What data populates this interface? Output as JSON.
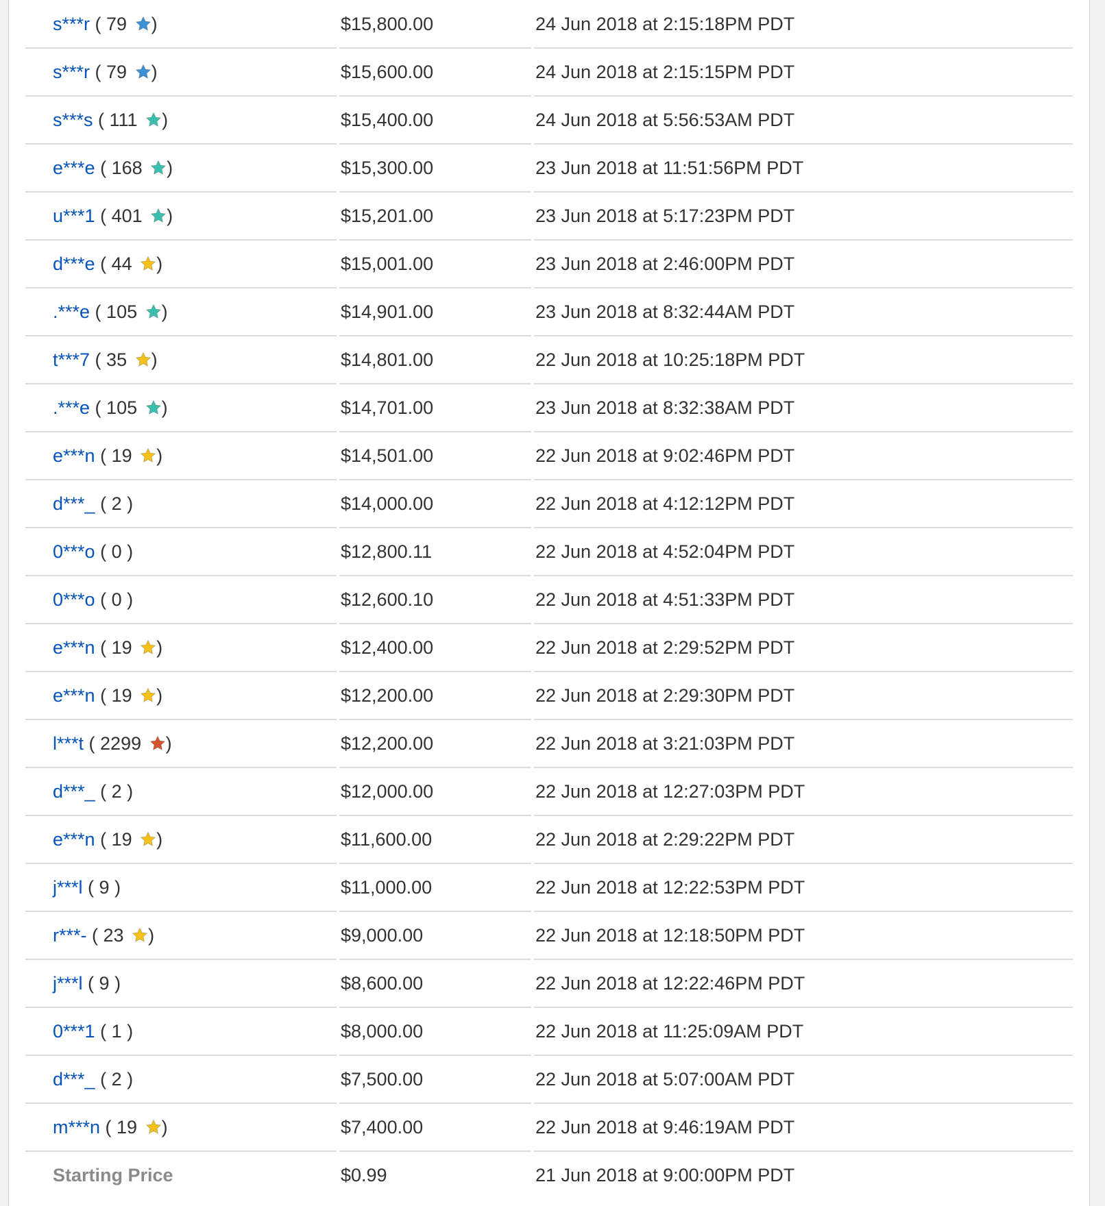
{
  "bids": [
    {
      "name": "s***r",
      "score": "79",
      "star": "blue",
      "amount": "$15,800.00",
      "time": "24 Jun 2018 at 2:15:18PM PDT"
    },
    {
      "name": "s***r",
      "score": "79",
      "star": "blue",
      "amount": "$15,600.00",
      "time": "24 Jun 2018 at 2:15:15PM PDT"
    },
    {
      "name": "s***s",
      "score": "111",
      "star": "teal",
      "amount": "$15,400.00",
      "time": "24 Jun 2018 at 5:56:53AM PDT"
    },
    {
      "name": "e***e",
      "score": "168",
      "star": "teal",
      "amount": "$15,300.00",
      "time": "23 Jun 2018 at 11:51:56PM PDT"
    },
    {
      "name": "u***1",
      "score": "401",
      "star": "teal",
      "amount": "$15,201.00",
      "time": "23 Jun 2018 at 5:17:23PM PDT"
    },
    {
      "name": "d***e",
      "score": "44",
      "star": "yellow",
      "amount": "$15,001.00",
      "time": "23 Jun 2018 at 2:46:00PM PDT"
    },
    {
      "name": ".***e",
      "score": "105",
      "star": "teal",
      "amount": "$14,901.00",
      "time": "23 Jun 2018 at 8:32:44AM PDT"
    },
    {
      "name": "t***7",
      "score": "35",
      "star": "yellow",
      "amount": "$14,801.00",
      "time": "22 Jun 2018 at 10:25:18PM PDT"
    },
    {
      "name": ".***e",
      "score": "105",
      "star": "teal",
      "amount": "$14,701.00",
      "time": "23 Jun 2018 at 8:32:38AM PDT"
    },
    {
      "name": "e***n",
      "score": "19",
      "star": "yellow",
      "amount": "$14,501.00",
      "time": "22 Jun 2018 at 9:02:46PM PDT"
    },
    {
      "name": "d***_",
      "score": "2",
      "star": "",
      "amount": "$14,000.00",
      "time": "22 Jun 2018 at 4:12:12PM PDT"
    },
    {
      "name": "0***o",
      "score": "0",
      "star": "",
      "amount": "$12,800.11",
      "time": "22 Jun 2018 at 4:52:04PM PDT"
    },
    {
      "name": "0***o",
      "score": "0",
      "star": "",
      "amount": "$12,600.10",
      "time": "22 Jun 2018 at 4:51:33PM PDT"
    },
    {
      "name": "e***n",
      "score": "19",
      "star": "yellow",
      "amount": "$12,400.00",
      "time": "22 Jun 2018 at 2:29:52PM PDT"
    },
    {
      "name": "e***n",
      "score": "19",
      "star": "yellow",
      "amount": "$12,200.00",
      "time": "22 Jun 2018 at 2:29:30PM PDT"
    },
    {
      "name": "l***t",
      "score": "2299",
      "star": "red",
      "amount": "$12,200.00",
      "time": "22 Jun 2018 at 3:21:03PM PDT"
    },
    {
      "name": "d***_",
      "score": "2",
      "star": "",
      "amount": "$12,000.00",
      "time": "22 Jun 2018 at 12:27:03PM PDT"
    },
    {
      "name": "e***n",
      "score": "19",
      "star": "yellow",
      "amount": "$11,600.00",
      "time": "22 Jun 2018 at 2:29:22PM PDT"
    },
    {
      "name": "j***l",
      "score": "9",
      "star": "",
      "amount": "$11,000.00",
      "time": "22 Jun 2018 at 12:22:53PM PDT"
    },
    {
      "name": "r***-",
      "score": "23",
      "star": "yellow",
      "amount": "$9,000.00",
      "time": "22 Jun 2018 at 12:18:50PM PDT"
    },
    {
      "name": "j***l",
      "score": "9",
      "star": "",
      "amount": "$8,600.00",
      "time": "22 Jun 2018 at 12:22:46PM PDT"
    },
    {
      "name": "0***1",
      "score": "1",
      "star": "",
      "amount": "$8,000.00",
      "time": "22 Jun 2018 at 11:25:09AM PDT"
    },
    {
      "name": "d***_",
      "score": "2",
      "star": "",
      "amount": "$7,500.00",
      "time": "22 Jun 2018 at 5:07:00AM PDT"
    },
    {
      "name": "m***n",
      "score": "19",
      "star": "yellow",
      "amount": "$7,400.00",
      "time": "22 Jun 2018 at 9:46:19AM PDT"
    }
  ],
  "starting": {
    "label": "Starting Price",
    "amount": "$0.99",
    "time": "21 Jun 2018 at 9:00:00PM PDT"
  },
  "star_colors": {
    "blue": "#3d8fd6",
    "teal": "#3cbfae",
    "yellow": "#f4c21a",
    "red": "#d2552d"
  }
}
